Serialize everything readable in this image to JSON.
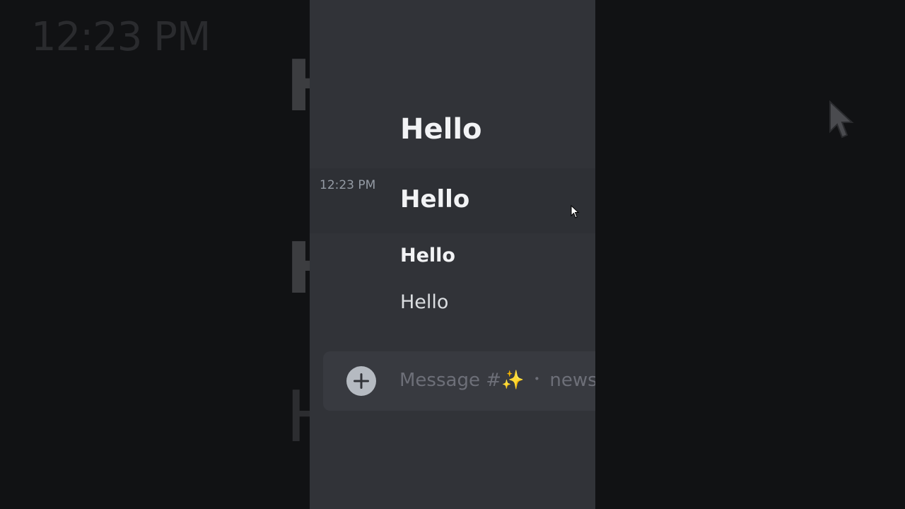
{
  "background": {
    "timestamp": "12:23 PM",
    "heading_fragment": "H"
  },
  "chat": {
    "timestamp": "12:23 PM",
    "messages": [
      {
        "style": "heading-1",
        "text": "Hello"
      },
      {
        "style": "heading-2",
        "text": "Hello"
      },
      {
        "style": "heading-3",
        "text": "Hello"
      },
      {
        "style": "paragraph",
        "text": "Hello"
      }
    ]
  },
  "composer": {
    "placeholder_prefix": "Message #",
    "channel_emoji": "✨",
    "separator": "・",
    "channel_name": "news",
    "add_button_icon": "plus-circle-icon"
  },
  "colors": {
    "panel_bg": "#313338",
    "outer_bg": "#111214",
    "composer_bg": "#383a40",
    "text": "#f2f3f5",
    "muted": "#949ba4"
  }
}
